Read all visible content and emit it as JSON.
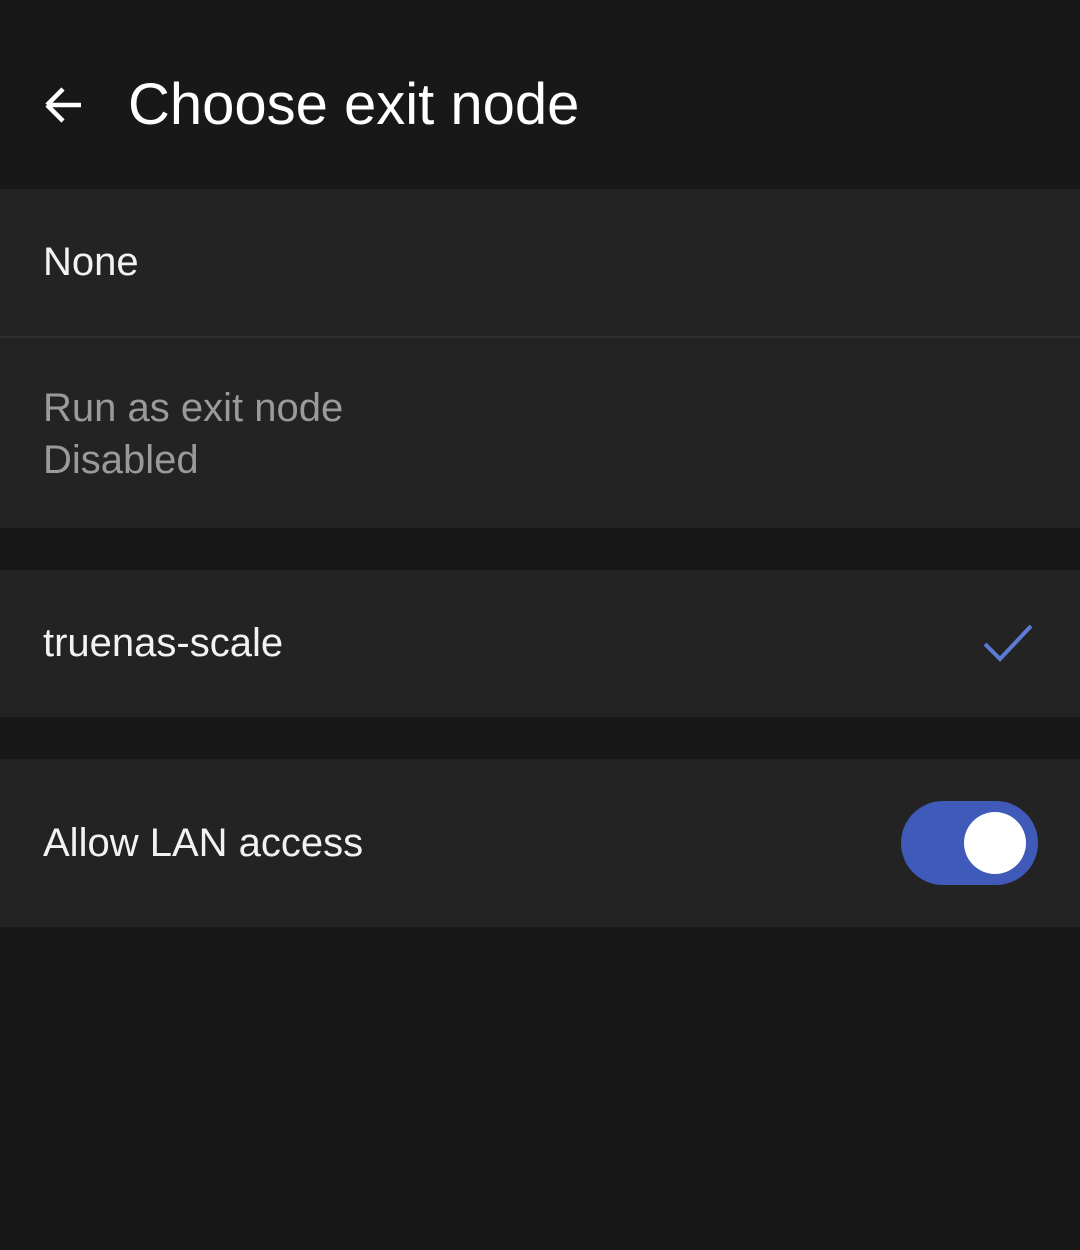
{
  "header": {
    "title": "Choose exit node",
    "back_icon": "arrow-back-icon"
  },
  "options": {
    "none_label": "None",
    "run_as_exit_node": {
      "title": "Run as exit node",
      "status": "Disabled"
    },
    "nodes": [
      {
        "label": "truenas-scale",
        "selected": true,
        "check_icon": "checkmark-icon"
      }
    ]
  },
  "lan_access": {
    "label": "Allow LAN access",
    "enabled": true
  },
  "colors": {
    "background": "#181818",
    "row_background": "#232323",
    "accent": "#3f5ab8",
    "check": "#5b7bd5",
    "disabled_text": "#9a9a9a"
  }
}
